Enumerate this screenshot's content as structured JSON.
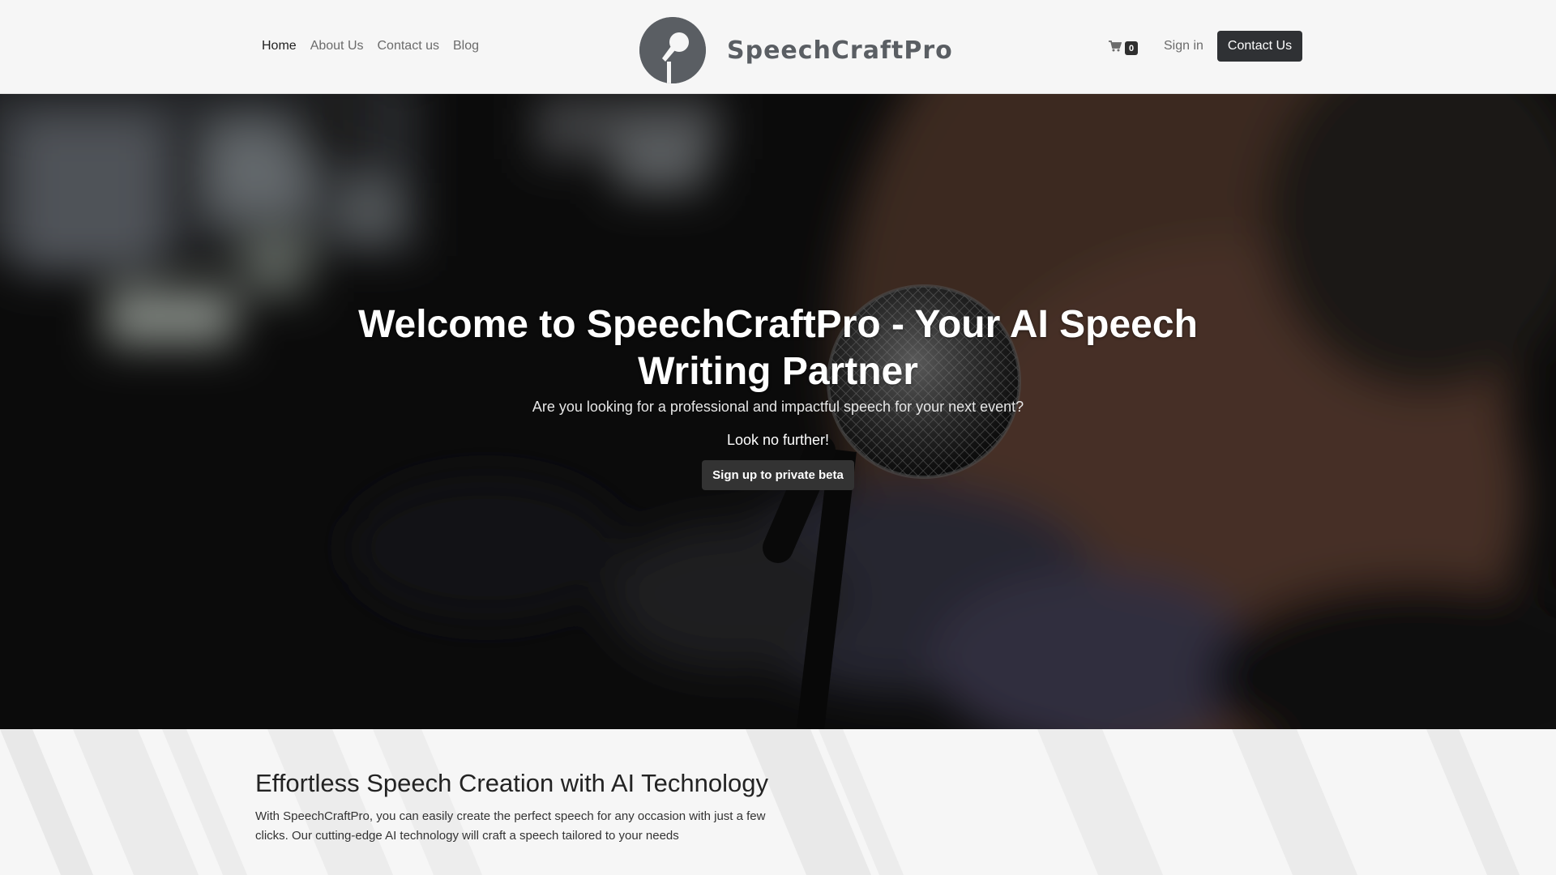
{
  "header": {
    "nav": {
      "home": "Home",
      "about": "About Us",
      "contact": "Contact us",
      "blog": "Blog"
    },
    "brand_name": "SpeechCraftPro",
    "logo_icon": "microphone-icon",
    "cart_count": "0",
    "cart_icon": "cart-icon",
    "sign_in": "Sign in",
    "contact_button": "Contact Us"
  },
  "hero": {
    "title": "Welcome to SpeechCraftPro - Your AI Speech Writing Partner",
    "subtitle": "Are you looking for a professional and impactful speech for your next event?",
    "tagline": "Look no further!",
    "cta": "Sign up to private beta"
  },
  "section": {
    "title": "Effortless Speech Creation with AI Technology",
    "text": "With SpeechCraftPro, you can easily create the perfect speech for any occasion with just a few clicks. Our cutting-edge AI technology will craft a speech tailored to your needs"
  },
  "colors": {
    "header_bg": "#f6f6f6",
    "primary_button": "#2f3134",
    "brand_gray": "#5a5e63"
  }
}
